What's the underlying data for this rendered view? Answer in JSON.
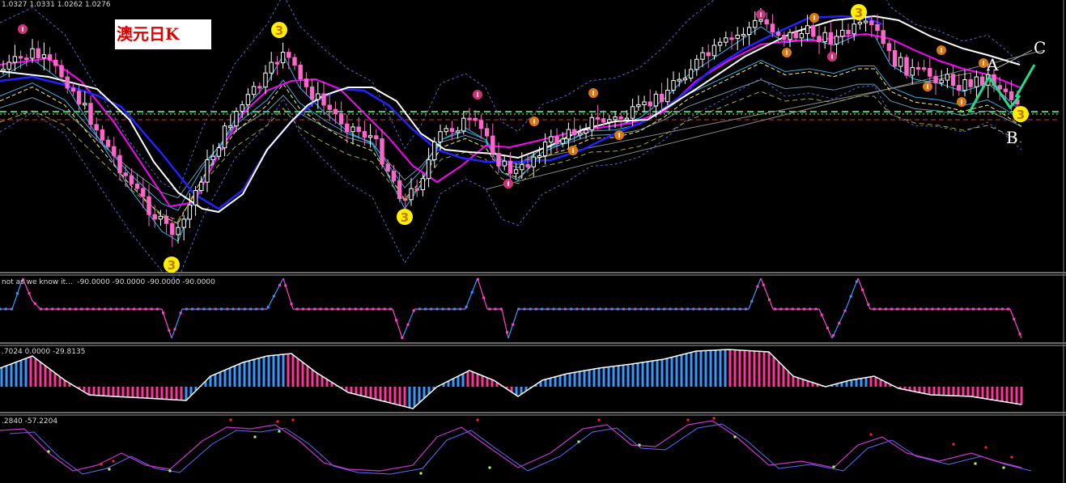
{
  "chart_data": [
    {
      "type": "candlestick",
      "title": "澳元日K",
      "ohlc_readout": "1.0327 1.0331 1.0262 1.0276",
      "wave_labels": [
        "A",
        "B",
        "C"
      ],
      "fractal_marker_label": "3",
      "colors": {
        "bull": "#ffffff",
        "bear": "#ff66cc",
        "ma_magenta": "#ff00ff",
        "ma_blue": "#2222ff",
        "ma_white": "#ffffff",
        "channel": "#4aa0ff",
        "marker_yellow": "#ffee00",
        "marker_pink": "#cc3377",
        "marker_orange": "#dd7711",
        "wave_green": "#22dd88"
      }
    },
    {
      "type": "line",
      "readout": "not as we know it...  -90.0000 -90.0000 -90.0000 -90.0000",
      "colors": {
        "up": "#3399ff",
        "down": "#ff44cc"
      }
    },
    {
      "type": "bar",
      "readout": ".7024 0.0000 -29.8135",
      "colors": {
        "pos": "#3399ff",
        "neg": "#ff3399",
        "line": "#ffffff"
      }
    },
    {
      "type": "line",
      "readout": ".2840 -57.2204",
      "colors": {
        "main": "#cc33cc",
        "signal": "#6666ff",
        "dot_high": "#ff2222",
        "dot_low": "#aaff66"
      }
    }
  ]
}
